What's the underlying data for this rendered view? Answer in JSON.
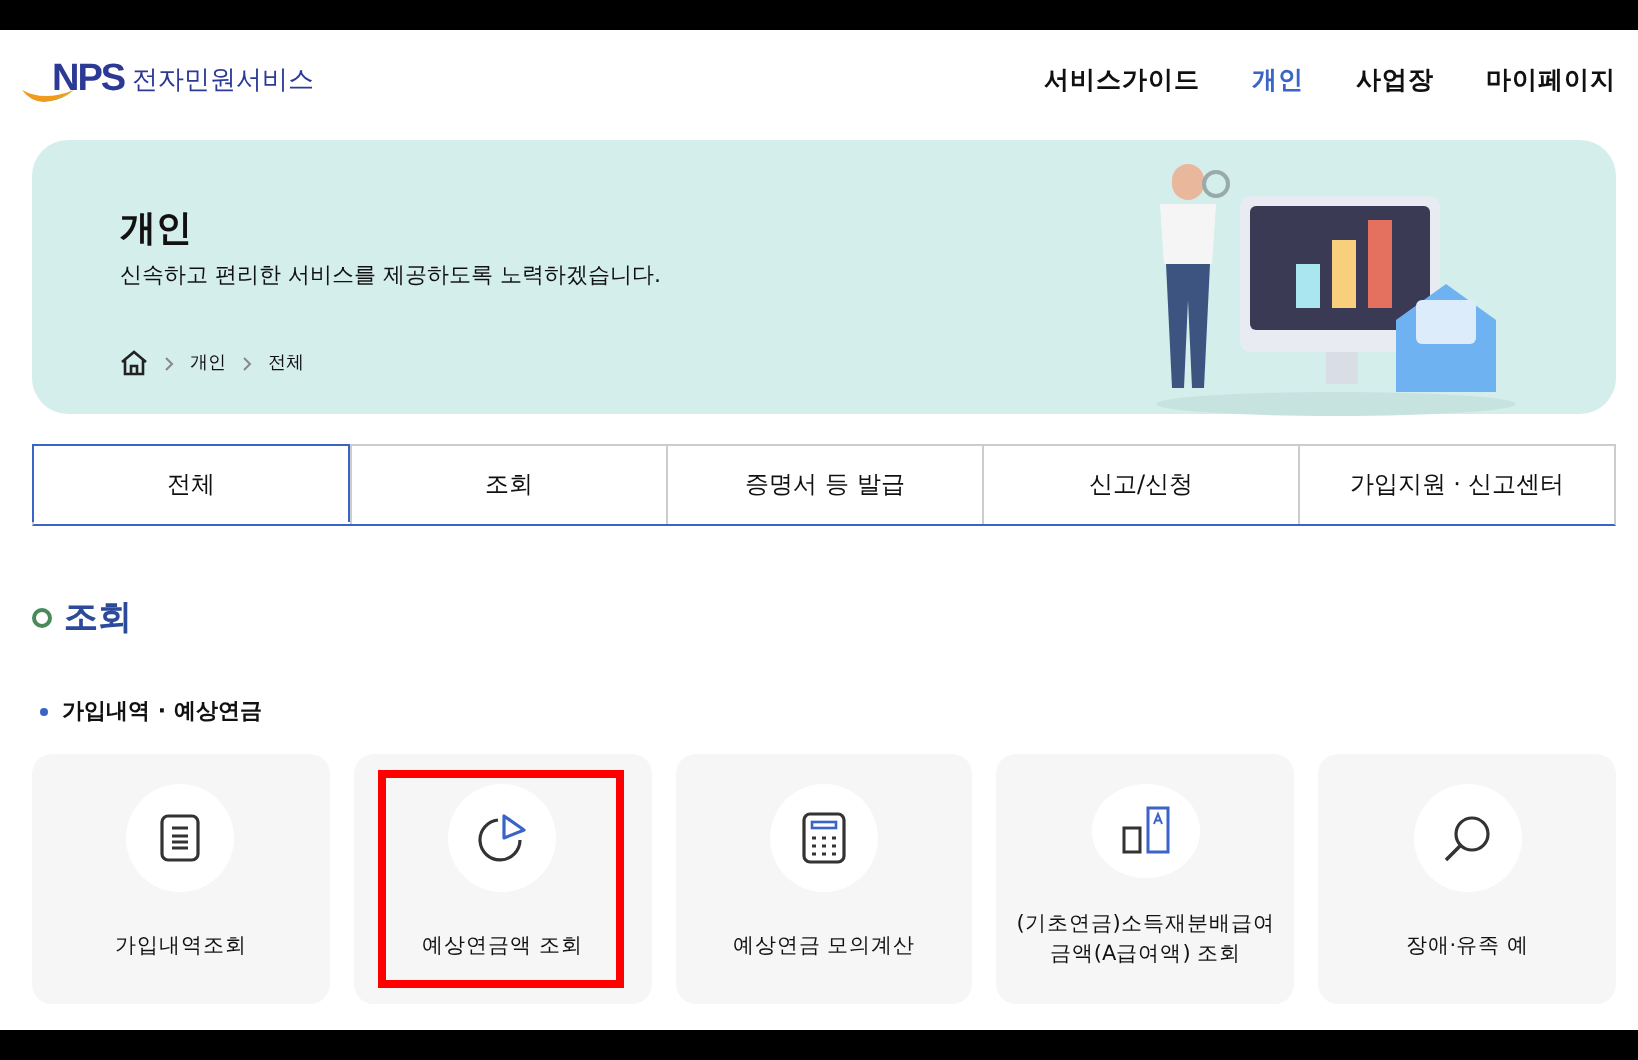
{
  "header": {
    "logo_text": "NPS",
    "service_name": "전자민원서비스",
    "nav": [
      {
        "label": "서비스가이드",
        "selected": false
      },
      {
        "label": "개인",
        "selected": true
      },
      {
        "label": "사업장",
        "selected": false
      },
      {
        "label": "마이페이지",
        "selected": false
      }
    ]
  },
  "banner": {
    "title": "개인",
    "subtitle": "신속하고 편리한 서비스를 제공하도록 노력하겠습니다.",
    "breadcrumb": [
      "개인",
      "전체"
    ]
  },
  "tabs": [
    {
      "label": "전체",
      "selected": true
    },
    {
      "label": "조회",
      "selected": false
    },
    {
      "label": "증명서 등 발급",
      "selected": false
    },
    {
      "label": "신고/신청",
      "selected": false
    },
    {
      "label": "가입지원 · 신고센터",
      "selected": false
    }
  ],
  "section": {
    "title": "조회",
    "subsection": "가입내역 · 예상연금",
    "cards": [
      {
        "kind": "document",
        "label": "가입내역조회",
        "highlighted": false
      },
      {
        "kind": "pie",
        "label": "예상연금액 조회",
        "highlighted": true
      },
      {
        "kind": "calculator",
        "label": "예상연금 모의계산",
        "highlighted": false
      },
      {
        "kind": "compare",
        "label": "(기초연금)소득재분배급여\n금액(A급여액) 조회",
        "highlighted": false
      },
      {
        "kind": "search",
        "label": "장애·유족 예",
        "highlighted": false
      }
    ]
  }
}
